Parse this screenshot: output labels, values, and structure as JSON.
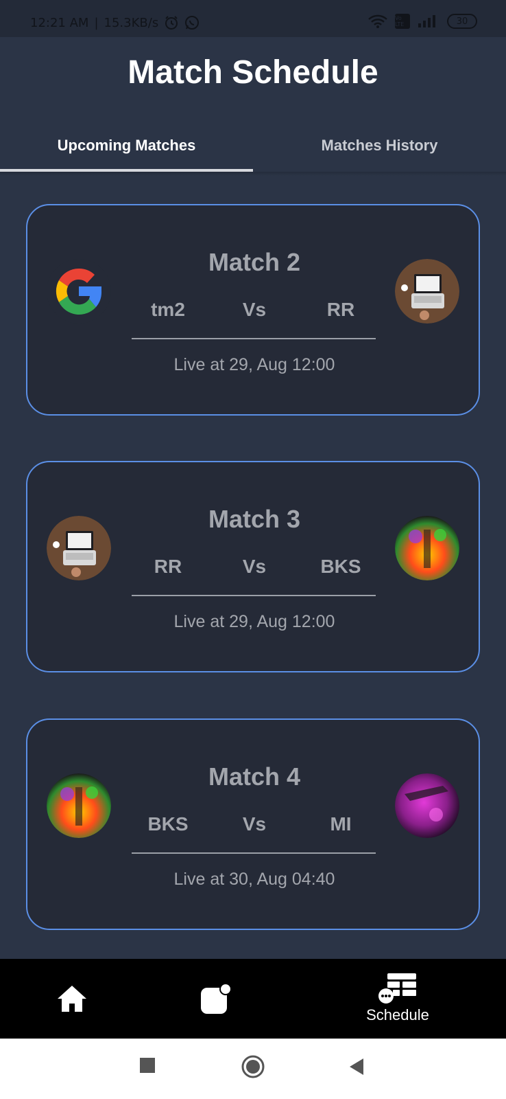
{
  "status_bar": {
    "time": "12:21 AM",
    "separator": "|",
    "speed": "15.3KB/s",
    "battery": "30",
    "volte": "Vo LTE"
  },
  "header": {
    "title": "Match Schedule",
    "tabs": [
      {
        "label": "Upcoming Matches",
        "active": true
      },
      {
        "label": "Matches History",
        "active": false
      }
    ]
  },
  "matches": [
    {
      "title": "Match 2",
      "team1": "tm2",
      "vs": "Vs",
      "team2": "RR",
      "live": "Live at 29, Aug 12:00",
      "team1_logo": "google-logo",
      "team2_logo": "laptop-photo"
    },
    {
      "title": "Match 3",
      "team1": "RR",
      "vs": "Vs",
      "team2": "BKS",
      "live": "Live at 29, Aug 12:00",
      "team1_logo": "laptop-photo",
      "team2_logo": "colorful-art"
    },
    {
      "title": "Match 4",
      "team1": "BKS",
      "vs": "Vs",
      "team2": "MI",
      "live": "Live at 30, Aug 04:40",
      "team1_logo": "colorful-art",
      "team2_logo": "purple-art"
    }
  ],
  "bottom_nav": {
    "items": [
      {
        "icon": "home-icon"
      },
      {
        "icon": "notification-icon"
      },
      {
        "icon": "schedule-icon",
        "label": "Schedule",
        "active": true
      }
    ]
  },
  "colors": {
    "background": "#2b3446",
    "card": "#252a37",
    "card_border": "#5b8fe6",
    "card_text": "#a3a6ad"
  }
}
